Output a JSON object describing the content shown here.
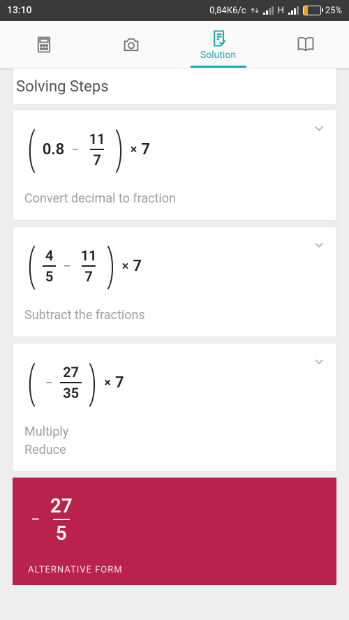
{
  "status": {
    "time": "13:10",
    "data_rate": "0,84К6/с",
    "network": "H",
    "battery_pct": "25%"
  },
  "tabs": {
    "calculator": "",
    "camera": "",
    "solution": "Solution",
    "book": ""
  },
  "header": "Solving Steps",
  "steps": [
    {
      "expr": {
        "a": "0.8",
        "b_num": "11",
        "b_den": "7",
        "mult": "7"
      },
      "label": "Convert decimal to fraction"
    },
    {
      "expr": {
        "a_num": "4",
        "a_den": "5",
        "b_num": "11",
        "b_den": "7",
        "mult": "7"
      },
      "label": "Subtract the fractions"
    },
    {
      "expr": {
        "neg": "−",
        "a_num": "27",
        "a_den": "35",
        "mult": "7"
      },
      "label": "Multiply\nReduce"
    }
  ],
  "result": {
    "neg": "−",
    "num": "27",
    "den": "5",
    "alt": "ALTERNATIVE FORM"
  }
}
